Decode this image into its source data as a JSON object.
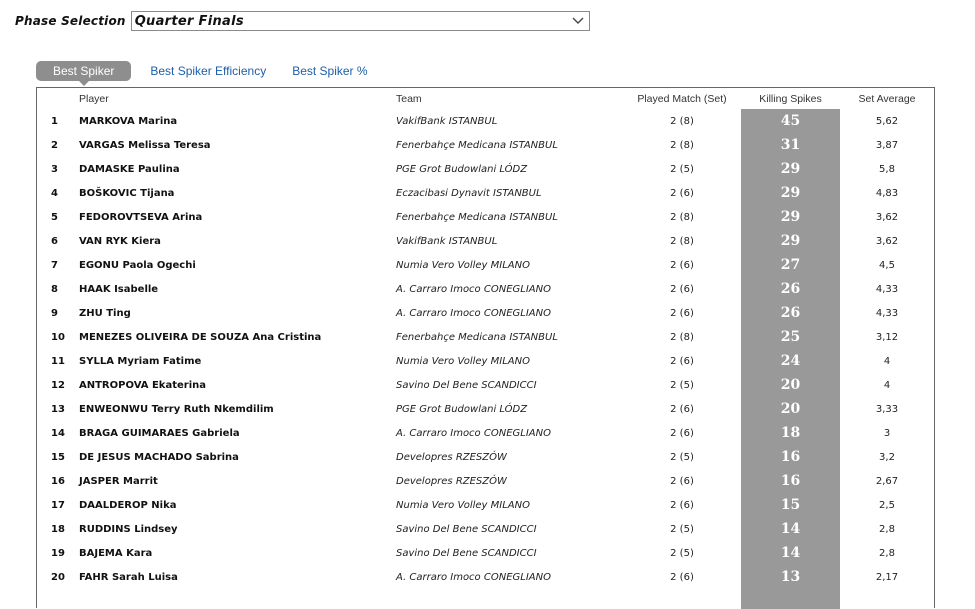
{
  "phase": {
    "label": "Phase Selection",
    "selected": "Quarter Finals"
  },
  "tabs": [
    {
      "label": "Best Spiker",
      "active": true
    },
    {
      "label": "Best Spiker Efficiency",
      "active": false
    },
    {
      "label": "Best Spiker %",
      "active": false
    }
  ],
  "table": {
    "headers": {
      "player": "Player",
      "team": "Team",
      "played": "Played Match (Set)",
      "killing": "Killing Spikes",
      "set_average": "Set Average"
    },
    "rows": [
      {
        "rank": "1",
        "player": "MARKOVA Marina",
        "team": "VakifBank ISTANBUL",
        "played": "2 (8)",
        "killing": "45",
        "avg": "5,62"
      },
      {
        "rank": "2",
        "player": "VARGAS Melissa Teresa",
        "team": "Fenerbahçe Medicana ISTANBUL",
        "played": "2 (8)",
        "killing": "31",
        "avg": "3,87"
      },
      {
        "rank": "3",
        "player": "DAMASKE Paulina",
        "team": "PGE Grot Budowlani LÓDZ",
        "played": "2 (5)",
        "killing": "29",
        "avg": "5,8"
      },
      {
        "rank": "4",
        "player": "BOŠKOVIC Tijana",
        "team": "Eczacibasi Dynavit ISTANBUL",
        "played": "2 (6)",
        "killing": "29",
        "avg": "4,83"
      },
      {
        "rank": "5",
        "player": "FEDOROVTSEVA Arina",
        "team": "Fenerbahçe Medicana ISTANBUL",
        "played": "2 (8)",
        "killing": "29",
        "avg": "3,62"
      },
      {
        "rank": "6",
        "player": "VAN RYK Kiera",
        "team": "VakifBank ISTANBUL",
        "played": "2 (8)",
        "killing": "29",
        "avg": "3,62"
      },
      {
        "rank": "7",
        "player": "EGONU Paola Ogechi",
        "team": "Numia Vero Volley MILANO",
        "played": "2 (6)",
        "killing": "27",
        "avg": "4,5"
      },
      {
        "rank": "8",
        "player": "HAAK Isabelle",
        "team": "A. Carraro Imoco CONEGLIANO",
        "played": "2 (6)",
        "killing": "26",
        "avg": "4,33"
      },
      {
        "rank": "9",
        "player": "ZHU Ting",
        "team": "A. Carraro Imoco CONEGLIANO",
        "played": "2 (6)",
        "killing": "26",
        "avg": "4,33"
      },
      {
        "rank": "10",
        "player": "MENEZES OLIVEIRA DE SOUZA Ana Cristina",
        "team": "Fenerbahçe Medicana ISTANBUL",
        "played": "2 (8)",
        "killing": "25",
        "avg": "3,12"
      },
      {
        "rank": "11",
        "player": "SYLLA Myriam Fatime",
        "team": "Numia Vero Volley MILANO",
        "played": "2 (6)",
        "killing": "24",
        "avg": "4"
      },
      {
        "rank": "12",
        "player": "ANTROPOVA Ekaterina",
        "team": "Savino Del Bene SCANDICCI",
        "played": "2 (5)",
        "killing": "20",
        "avg": "4"
      },
      {
        "rank": "13",
        "player": "ENWEONWU Terry Ruth Nkemdilim",
        "team": "PGE Grot Budowlani LÓDZ",
        "played": "2 (6)",
        "killing": "20",
        "avg": "3,33"
      },
      {
        "rank": "14",
        "player": "BRAGA GUIMARAES Gabriela",
        "team": "A. Carraro Imoco CONEGLIANO",
        "played": "2 (6)",
        "killing": "18",
        "avg": "3"
      },
      {
        "rank": "15",
        "player": "DE JESUS MACHADO Sabrina",
        "team": "Developres RZESZÓW",
        "played": "2 (5)",
        "killing": "16",
        "avg": "3,2"
      },
      {
        "rank": "16",
        "player": "JASPER Marrit",
        "team": "Developres RZESZÓW",
        "played": "2 (6)",
        "killing": "16",
        "avg": "2,67"
      },
      {
        "rank": "17",
        "player": "DAALDEROP Nika",
        "team": "Numia Vero Volley MILANO",
        "played": "2 (6)",
        "killing": "15",
        "avg": "2,5"
      },
      {
        "rank": "18",
        "player": "RUDDINS Lindsey",
        "team": "Savino Del Bene SCANDICCI",
        "played": "2 (5)",
        "killing": "14",
        "avg": "2,8"
      },
      {
        "rank": "19",
        "player": "BAJEMA Kara",
        "team": "Savino Del Bene SCANDICCI",
        "played": "2 (5)",
        "killing": "14",
        "avg": "2,8"
      },
      {
        "rank": "20",
        "player": "FAHR Sarah Luisa",
        "team": "A. Carraro Imoco CONEGLIANO",
        "played": "2 (6)",
        "killing": "13",
        "avg": "2,17"
      }
    ]
  },
  "colors": {
    "highlight_column": "#999999",
    "link": "#1e5fa8",
    "active_tab": "#8e8e8e"
  }
}
